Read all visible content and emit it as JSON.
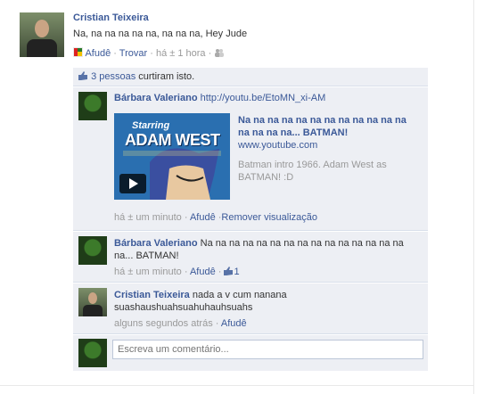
{
  "post": {
    "author": "Cristian Teixeira",
    "message": "Na, na na na na na, na na na, Hey Jude",
    "actions": {
      "help": "Afudê",
      "change": "Trovar",
      "time": "há ± 1 hora"
    },
    "sep": "·"
  },
  "likes": {
    "count_link": "3 pessoas",
    "suffix": " curtiram isto."
  },
  "comments": [
    {
      "author": "Bárbara Valeriano",
      "text": "http://youtu.be/EtoMN_xi-AM",
      "video": {
        "title": "Na na na na na na na na na na na na na na na na... BATMAN!",
        "domain": "www.youtube.com",
        "description": "Batman intro 1966. Adam West as BATMAN! :D",
        "thumb_text_1": "Starring",
        "thumb_text_2": "ADAM WEST"
      },
      "time": "há ± um minuto",
      "help": "Afudê",
      "remove": "Remover visualização"
    },
    {
      "author": "Bárbara Valeriano",
      "text": "Na na na na na na na na na na na na na na na na... BATMAN!",
      "time": "há ± um minuto",
      "help": "Afudê",
      "likes": "1"
    },
    {
      "author": "Cristian Teixeira",
      "text": "nada a v cum nanana suashaushuahsuahuhauhsuahs",
      "time": "alguns segundos atrás",
      "help": "Afudê"
    }
  ],
  "composer": {
    "placeholder": "Escreva um comentário..."
  }
}
